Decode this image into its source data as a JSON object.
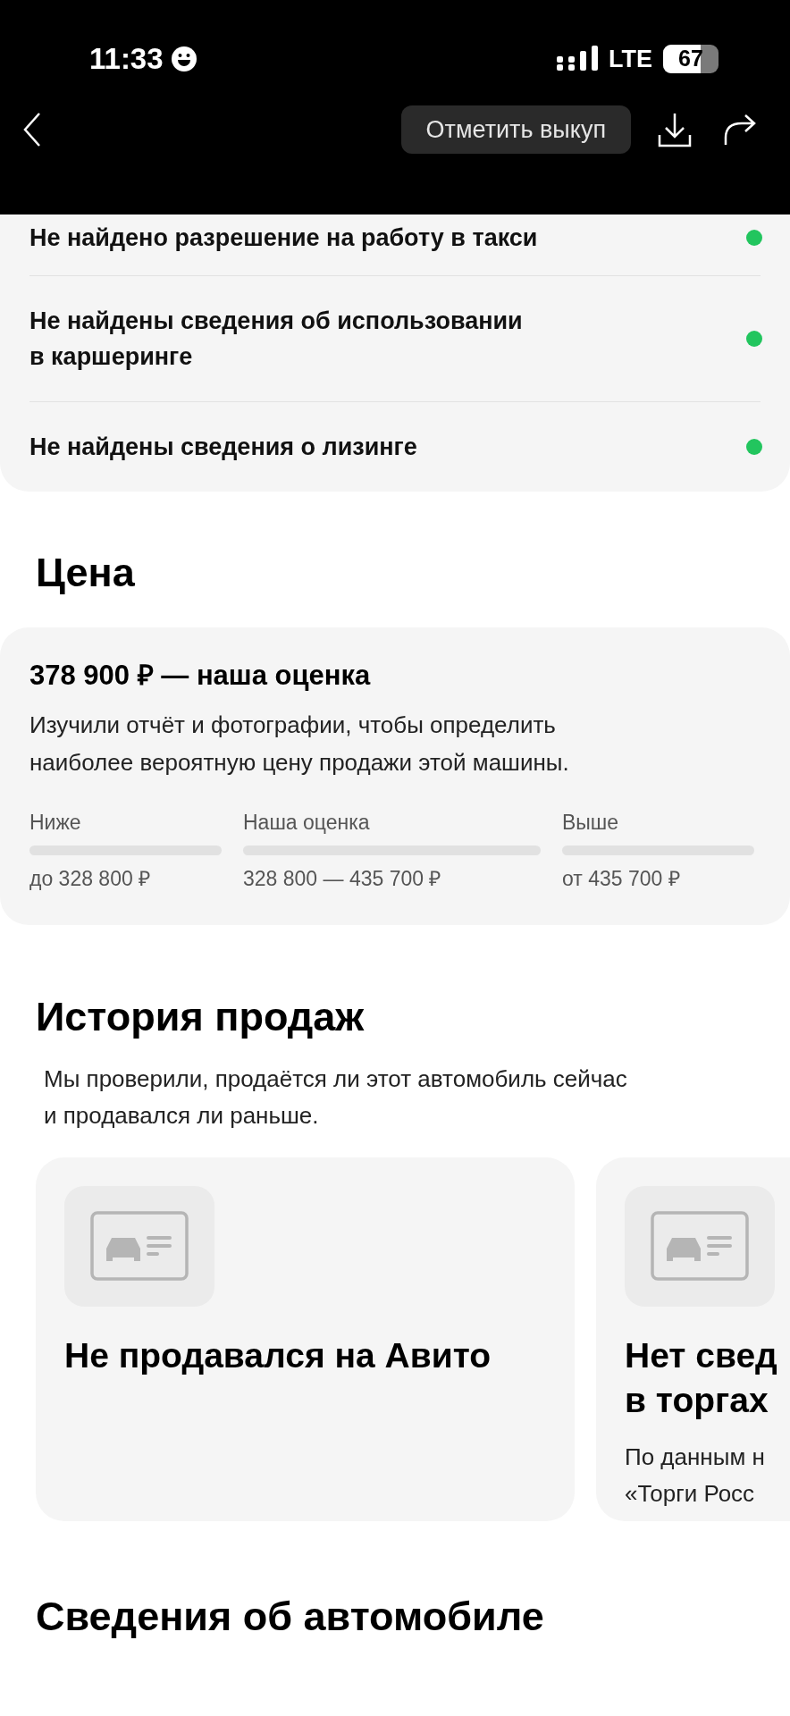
{
  "status_bar": {
    "time": "11:33",
    "network": "LTE",
    "battery": "67"
  },
  "toolbar": {
    "action_button": "Отметить выкуп"
  },
  "checks": [
    {
      "text": "Не найдено разрешение на работу в такси",
      "color": "#22c55e"
    },
    {
      "text": "Не найдены сведения об использовании\nв каршеринге",
      "color": "#22c55e"
    },
    {
      "text": "Не найдены сведения о лизинге",
      "color": "#22c55e"
    }
  ],
  "price": {
    "heading": "Цена",
    "title": "378 900 ₽ — наша оценка",
    "description": "Изучили отчёт и фотографии, чтобы определить\nнаиболее вероятную цену продажи этой машины.",
    "ranges": [
      {
        "label": "Ниже",
        "value": "до 328 800 ₽"
      },
      {
        "label": "Наша оценка",
        "value": "328 800 — 435 700 ₽"
      },
      {
        "label": "Выше",
        "value": "от 435 700 ₽"
      }
    ]
  },
  "sales_history": {
    "heading": "История продаж",
    "description": "Мы проверили, продаётся ли этот автомобиль сейчас\nи продавался ли раньше.",
    "cards": [
      {
        "title": "Не продавался на Авито"
      },
      {
        "title": "Нет свед\nв торгах",
        "description": "По данным н\n«Торги Росс"
      }
    ]
  },
  "next_heading": "Сведения об автомобиле"
}
